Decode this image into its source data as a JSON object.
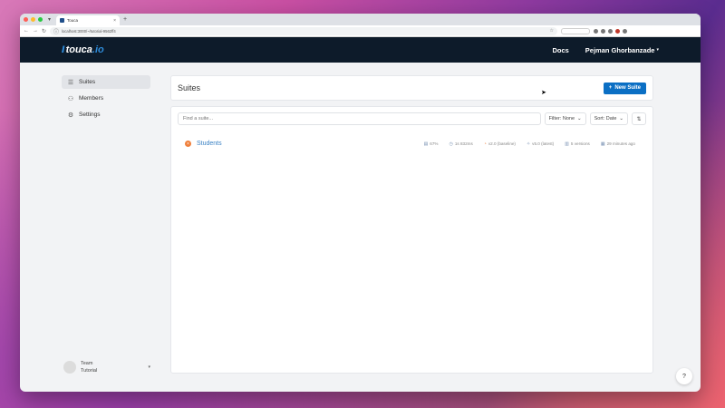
{
  "browser": {
    "tab_title": "Touca",
    "url": "localhost:3000/~/tutorial-9562ff4",
    "tab_close": "×",
    "new_tab": "+"
  },
  "header": {
    "logo": "touca.io",
    "logo_main": "touca",
    "logo_suffix": ".io",
    "docs": "Docs",
    "user": "Pejman Ghorbanzade"
  },
  "sidebar": {
    "items": [
      {
        "label": "Suites",
        "icon": "list-icon",
        "active": true
      },
      {
        "label": "Members",
        "icon": "users-icon",
        "active": false
      },
      {
        "label": "Settings",
        "icon": "gear-icon",
        "active": false
      }
    ],
    "team_label": "Team",
    "team_name": "Tutorial"
  },
  "main": {
    "title": "Suites",
    "new_button": "New Suite",
    "search_placeholder": "Find a suite...",
    "filter": "Filter: None",
    "sort": "Sort: Date",
    "suites": [
      {
        "name": "Students",
        "score": "67%",
        "duration": "1s 832ms",
        "baseline": "v2.0 (baseline)",
        "latest": "v5.0 (latest)",
        "versions": "5 versions",
        "updated": "29 minutes ago"
      }
    ]
  },
  "help": "?",
  "colors": {
    "header_bg": "#0d1b2a",
    "accent": "#0b6fc4",
    "link": "#3b82c4",
    "status": "#ef7f3b"
  }
}
